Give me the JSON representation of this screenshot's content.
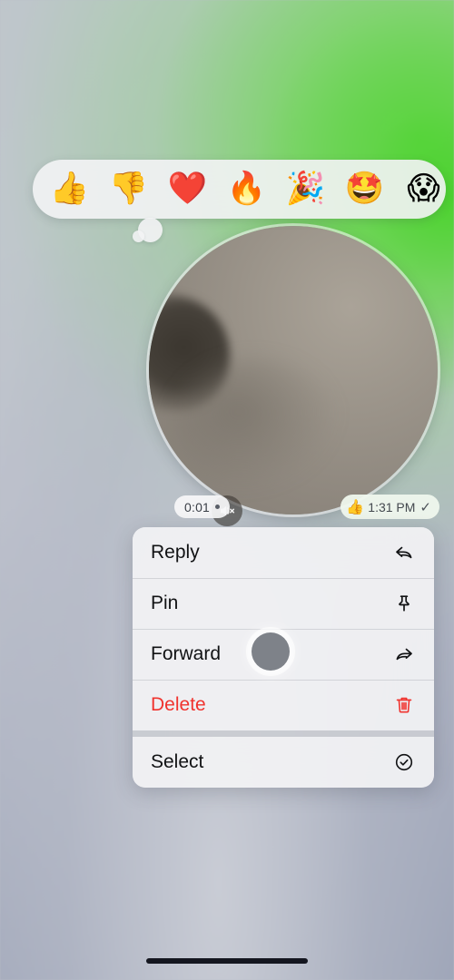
{
  "app": {
    "screen_name": "Message context menu",
    "accent_destructive": "#F0332E",
    "accent_green": "#58D63C",
    "menu_text_color": "#111214"
  },
  "reaction_bar": {
    "reactions": [
      {
        "name": "thumbs-up",
        "glyph": "👍"
      },
      {
        "name": "thumbs-down",
        "glyph": "👎"
      },
      {
        "name": "red-heart",
        "glyph": "❤️"
      },
      {
        "name": "fire",
        "glyph": "🔥"
      },
      {
        "name": "party-popper",
        "glyph": "🎉"
      },
      {
        "name": "star-struck",
        "glyph": "🤩"
      },
      {
        "name": "screaming-face",
        "glyph": "😱"
      }
    ]
  },
  "message": {
    "type": "round-video-note",
    "duration": "0:01",
    "timestamp": "1:31 PM",
    "delivery_status": "✓",
    "applied_reaction": "👍",
    "audio_muted": true
  },
  "context_menu": {
    "items": [
      {
        "label": "Reply",
        "icon": "reply-icon",
        "destructive": false
      },
      {
        "label": "Pin",
        "icon": "pin-icon",
        "destructive": false
      },
      {
        "label": "Forward",
        "icon": "forward-icon",
        "destructive": false
      },
      {
        "label": "Delete",
        "icon": "trash-icon",
        "destructive": true
      },
      {
        "label": "Select",
        "icon": "check-circle-icon",
        "destructive": false
      }
    ]
  }
}
